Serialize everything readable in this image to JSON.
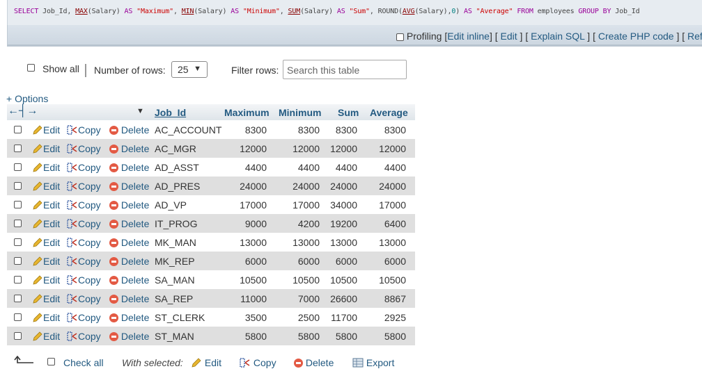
{
  "sql_query": {
    "parts": [
      {
        "t": "SELECT",
        "c": "kw"
      },
      {
        "t": " Job_Id, ",
        "c": ""
      },
      {
        "t": "MAX",
        "c": "fn"
      },
      {
        "t": "(Salary) ",
        "c": ""
      },
      {
        "t": "AS",
        "c": "kw"
      },
      {
        "t": " ",
        "c": ""
      },
      {
        "t": "\"Maximum\"",
        "c": "str"
      },
      {
        "t": ", ",
        "c": ""
      },
      {
        "t": "MIN",
        "c": "fn"
      },
      {
        "t": "(Salary) ",
        "c": ""
      },
      {
        "t": "AS",
        "c": "kw"
      },
      {
        "t": " ",
        "c": ""
      },
      {
        "t": "\"Minimum\"",
        "c": "str"
      },
      {
        "t": ", ",
        "c": ""
      },
      {
        "t": "SUM",
        "c": "fn"
      },
      {
        "t": "(Salary) ",
        "c": ""
      },
      {
        "t": "AS",
        "c": "kw"
      },
      {
        "t": " ",
        "c": ""
      },
      {
        "t": "\"Sum\"",
        "c": "str"
      },
      {
        "t": ", ROUND(",
        "c": ""
      },
      {
        "t": "AVG",
        "c": "fn"
      },
      {
        "t": "(Salary),",
        "c": ""
      },
      {
        "t": "0",
        "c": "num"
      },
      {
        "t": ") ",
        "c": ""
      },
      {
        "t": "AS",
        "c": "kw"
      },
      {
        "t": " ",
        "c": ""
      },
      {
        "t": "\"Average\"",
        "c": "str"
      },
      {
        "t": " ",
        "c": ""
      },
      {
        "t": "FROM",
        "c": "kw"
      },
      {
        "t": " employees ",
        "c": ""
      },
      {
        "t": "GROUP BY",
        "c": "kw"
      },
      {
        "t": " Job_Id",
        "c": ""
      }
    ]
  },
  "tools": {
    "profiling_label": "Profiling",
    "links": [
      "Edit inline",
      "Edit",
      "Explain SQL",
      "Create PHP code",
      "Refresh"
    ]
  },
  "nav": {
    "show_all": "Show all",
    "rows_label": "Number of rows:",
    "rows_value": "25",
    "filter_label": "Filter rows:",
    "filter_placeholder": "Search this table"
  },
  "options_label": "+ Options",
  "table": {
    "headers": [
      "Job_Id",
      "Maximum",
      "Minimum",
      "Sum",
      "Average"
    ],
    "actions": {
      "edit": "Edit",
      "copy": "Copy",
      "delete": "Delete"
    },
    "rows": [
      [
        "AC_ACCOUNT",
        "8300",
        "8300",
        "8300",
        "8300"
      ],
      [
        "AC_MGR",
        "12000",
        "12000",
        "12000",
        "12000"
      ],
      [
        "AD_ASST",
        "4400",
        "4400",
        "4400",
        "4400"
      ],
      [
        "AD_PRES",
        "24000",
        "24000",
        "24000",
        "24000"
      ],
      [
        "AD_VP",
        "17000",
        "17000",
        "34000",
        "17000"
      ],
      [
        "IT_PROG",
        "9000",
        "4200",
        "19200",
        "6400"
      ],
      [
        "MK_MAN",
        "13000",
        "13000",
        "13000",
        "13000"
      ],
      [
        "MK_REP",
        "6000",
        "6000",
        "6000",
        "6000"
      ],
      [
        "SA_MAN",
        "10500",
        "10500",
        "10500",
        "10500"
      ],
      [
        "SA_REP",
        "11000",
        "7000",
        "26600",
        "8867"
      ],
      [
        "ST_CLERK",
        "3500",
        "2500",
        "11700",
        "2925"
      ],
      [
        "ST_MAN",
        "5800",
        "5800",
        "5800",
        "5800"
      ]
    ]
  },
  "bottom": {
    "check_all": "Check all",
    "with_selected": "With selected:",
    "edit": "Edit",
    "copy": "Copy",
    "delete": "Delete",
    "export": "Export"
  }
}
